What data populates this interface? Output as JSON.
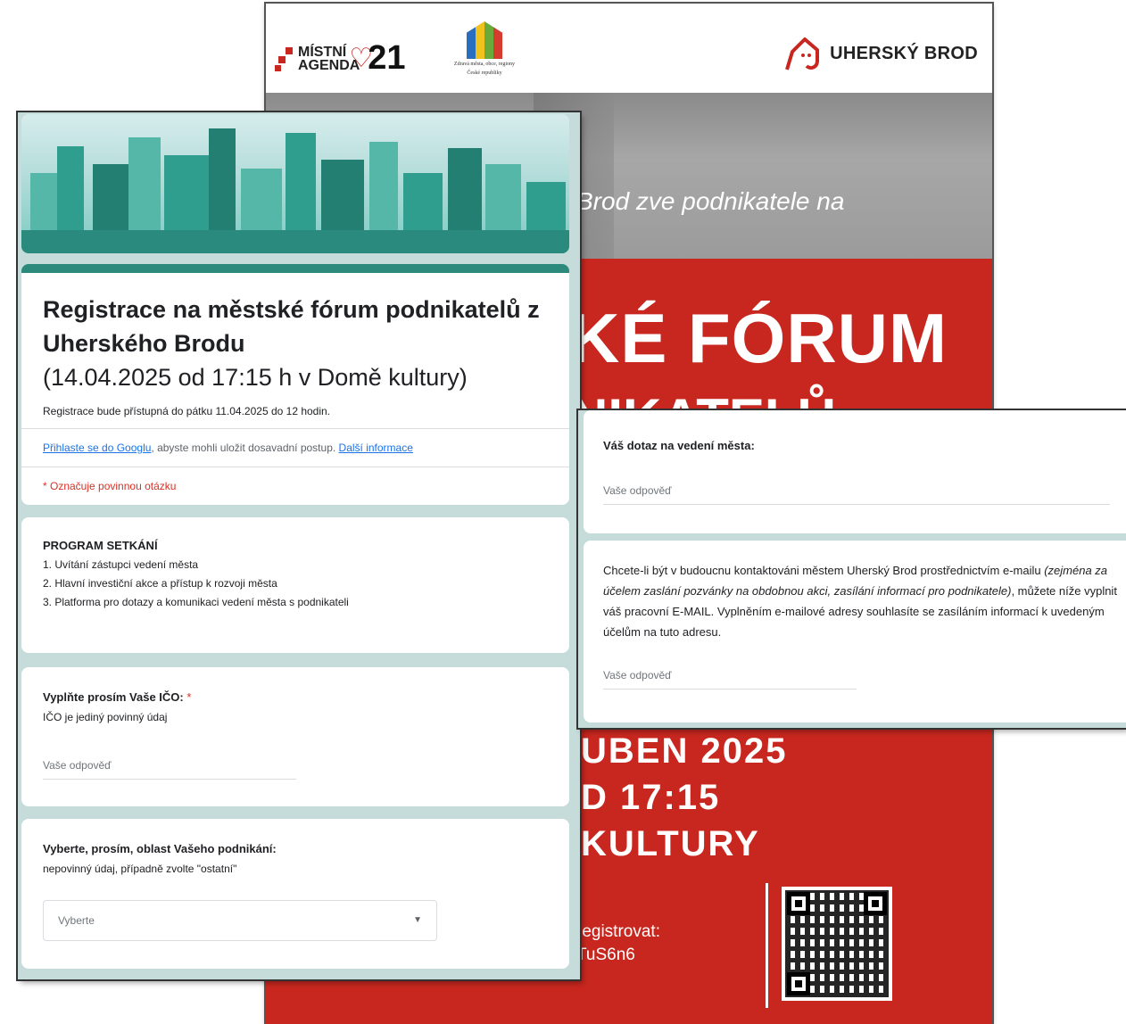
{
  "poster": {
    "logo_ma21_line1": "MÍSTNÍ",
    "logo_ma21_line2": "AGENDA",
    "logo_ma21_num": "21",
    "logo_zdrava_line1": "Zdravá města, obce, regiony",
    "logo_zdrava_line2": "České republiky",
    "logo_ub": "UHERSKÝ BROD",
    "tagline": "Brod zve podnikatele na",
    "headline1": "KÉ FÓRUM",
    "headline2": "NIKATELŮ",
    "date_line1": "UBEN 2025",
    "date_line2": "D 17:15",
    "date_line3": "KULTURY",
    "reg_line1": "registrovat:",
    "reg_line2": "TuS6n6",
    "accent_color": "#c8271f"
  },
  "form": {
    "title_bold": "Registrace na městské fórum podnikatelů z Uherského Brodu",
    "title_sub": "(14.04.2025 od 17:15 h v Domě kultury)",
    "note": "Registrace bude přístupná do  pátku 11.04.2025 do 12 hodin.",
    "signin_link": "Přihlaste se do Googlu",
    "signin_text": ", abyste mohli uložit dosavadní postup. ",
    "more_link": "Další informace",
    "required_note": "* Označuje povinnou otázku",
    "program": {
      "heading": "PROGRAM SETKÁNÍ",
      "items": [
        "1. Uvítání zástupci vedení města",
        "2. Hlavní investiční akce a přístup k rozvoji města",
        "3. Platforma pro dotazy a komunikaci vedení města s podnikateli"
      ]
    },
    "ico": {
      "question": "Vyplňte prosím Vaše IČO:",
      "required_mark": "*",
      "description": "IČO je jediný povinný údaj",
      "placeholder": "Vaše odpověď"
    },
    "obor": {
      "question": "Vyberte, prosím, oblast Vašeho podnikání:",
      "description": "nepovinný údaj, případně zvolte \"ostatní\"",
      "select_value": "Vyberte"
    }
  },
  "form_right": {
    "dotaz": {
      "question": "Váš dotaz na vedení města:",
      "placeholder": "Vaše odpověď"
    },
    "email": {
      "text1": "Chcete-li být v budoucnu kontaktováni městem Uherský Brod prostřednictvím e-mailu ",
      "text2": "(zejména za účelem zaslání pozvánky na obdobnou akci, zasílání informací pro podnikatele)",
      "text3": ", můžete níže vyplnit váš pracovní E-MAIL. Vyplněním e-mailové adresy souhlasíte se zasíláním informací k uvedeným účelům na tuto adresu.",
      "placeholder": "Vaše odpověď"
    }
  }
}
